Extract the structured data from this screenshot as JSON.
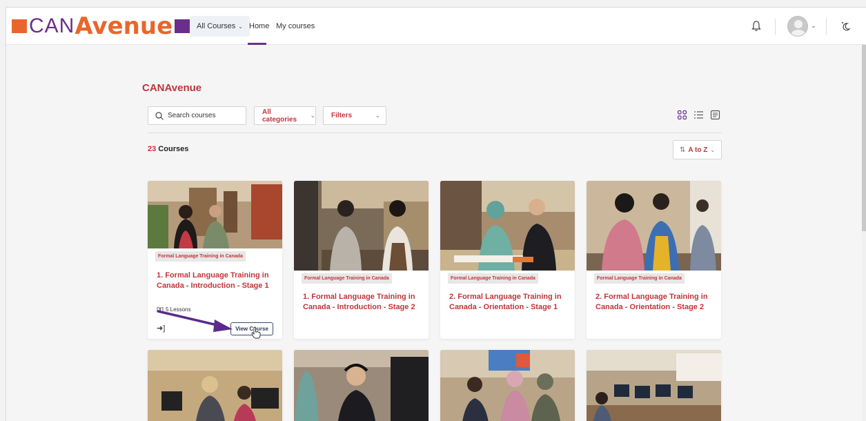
{
  "header": {
    "logo_prefix": "CAN",
    "logo_suffix": "Avenue",
    "all_courses": "All Courses",
    "nav_home": "Home",
    "nav_my_courses": "My courses"
  },
  "main": {
    "site_title": "CANAvenue",
    "search_placeholder": "Search courses",
    "categories_label": "All categories",
    "filters_label": "Filters",
    "count_number": "23",
    "count_suffix": " Courses",
    "sort_label": "A to Z"
  },
  "cards": [
    {
      "tag": "Formal Language Training in Canada",
      "title": "1. Formal Language Training in Canada - Introduction - Stage 1",
      "lessons": "5 Lessons",
      "button": "View Course"
    },
    {
      "tag": "Formal Language Training in Canada",
      "title": "1. Formal Language Training in Canada - Introduction - Stage 2"
    },
    {
      "tag": "Formal Language Training in Canada",
      "title": "2. Formal Language Training in Canada - Orientation - Stage 1"
    },
    {
      "tag": "Formal Language Training in Canada",
      "title": "2. Formal Language Training in Canada - Orientation - Stage 2"
    }
  ],
  "colors": {
    "brand_red": "#c2343a",
    "brand_orange": "#e8662b",
    "brand_purple": "#6a2e8c",
    "button_navy": "#2d3a59"
  }
}
